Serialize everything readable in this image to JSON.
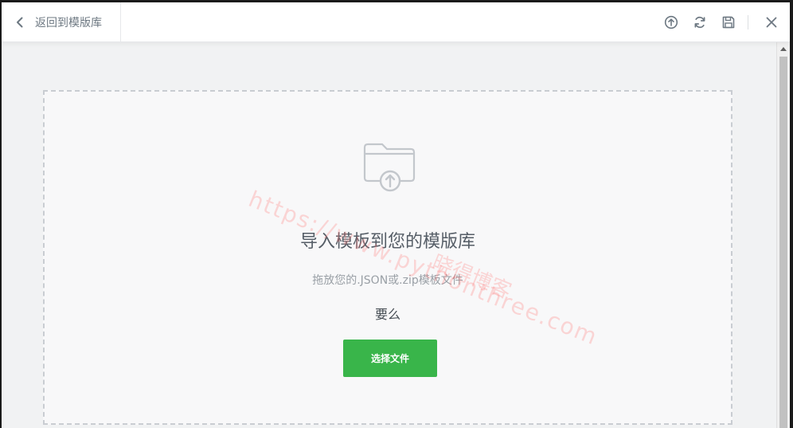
{
  "header": {
    "back_label": "返回到模版库",
    "tools": [
      {
        "name": "upload-icon"
      },
      {
        "name": "sync-icon"
      },
      {
        "name": "save-icon"
      }
    ],
    "close_icon": "close-icon"
  },
  "dropzone": {
    "title": "导入模板到您的模版库",
    "subtitle": "拖放您的.JSON或.zip模板文件",
    "or_text": "要么",
    "button_label": "选择文件",
    "icon": "folder-upload-icon"
  },
  "watermark": {
    "url": "https://www.pythonthree.com",
    "name": "晓得博客"
  },
  "colors": {
    "accent_green": "#39b54a",
    "icon_gray": "#6d7882"
  }
}
